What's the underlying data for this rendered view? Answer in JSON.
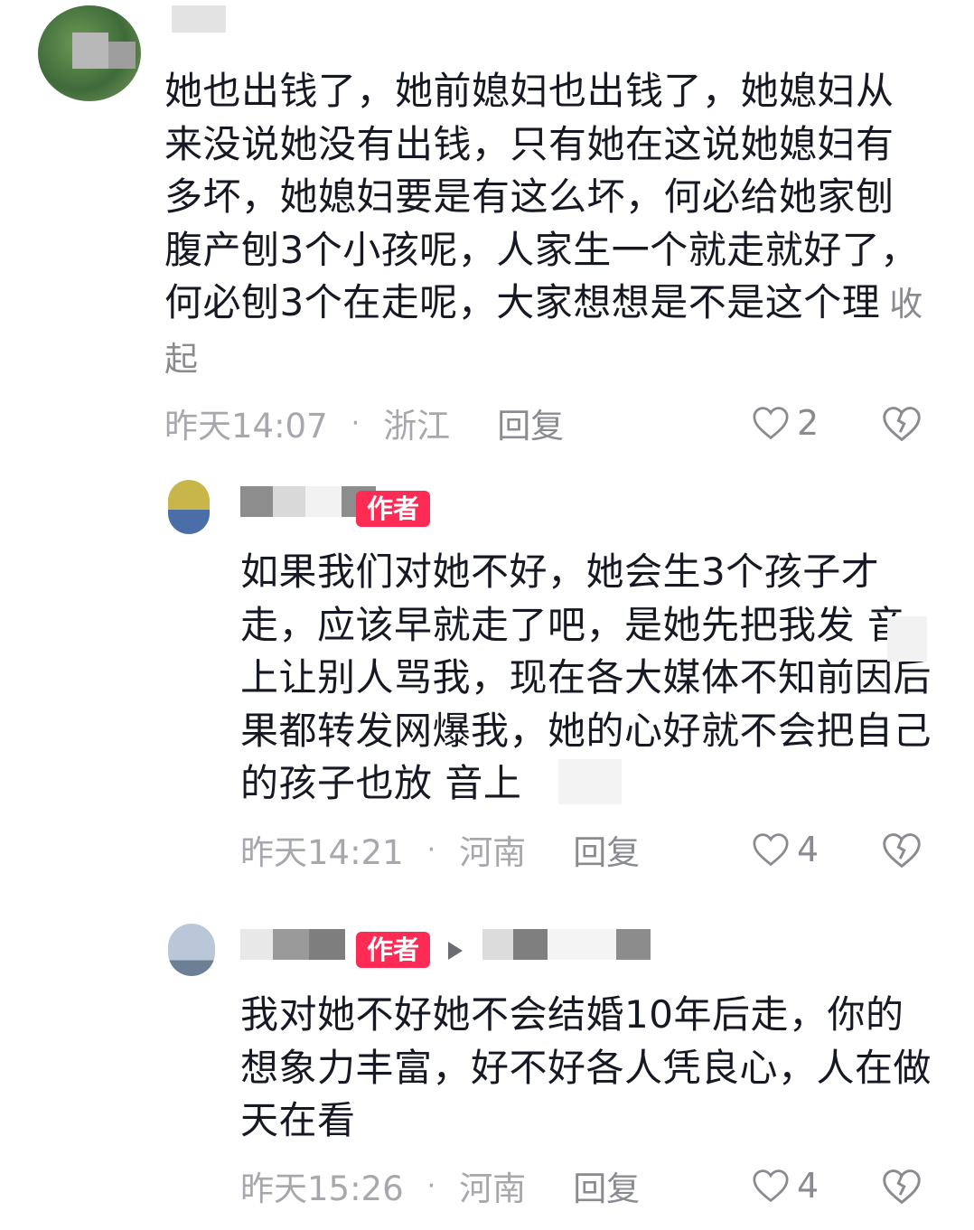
{
  "comments": [
    {
      "text": "她也出钱了，她前媳妇也出钱了，她媳妇从来没说她没有出钱，只有她在这说她媳妇有多坏，她媳妇要是有这么坏，何必给她家刨腹产刨3个小孩呢，人家生一个就走就好了，何必刨3个在走呢，大家想想是不是这个理",
      "collapse_label": "收起",
      "time": "昨天14:07",
      "location": "浙江",
      "reply_label": "回复",
      "likes": "2"
    },
    {
      "author_tag": "作者",
      "text": "如果我们对她不好，她会生3个孩子才走，应该早就走了吧，是她先把我发  音上让别人骂我，现在各大媒体不知前因后果都转发网爆我，她的心好就不会把自己的孩子也放    音上",
      "time": "昨天14:21",
      "location": "河南",
      "reply_label": "回复",
      "likes": "4"
    },
    {
      "author_tag": "作者",
      "text": "我对她不好她不会结婚10年后走，你的想象力丰富，好不好各人凭良心，人在做天在看",
      "time": "昨天15:26",
      "location": "河南",
      "reply_label": "回复",
      "likes": "4"
    }
  ],
  "icons": {
    "like": "heart-outline-icon",
    "dislike": "broken-heart-icon",
    "reply_to": "play-triangle-icon"
  },
  "colors": {
    "author_tag_bg": "#fe2c55",
    "meta_text": "#a7a8ad",
    "body_text": "#161823"
  }
}
